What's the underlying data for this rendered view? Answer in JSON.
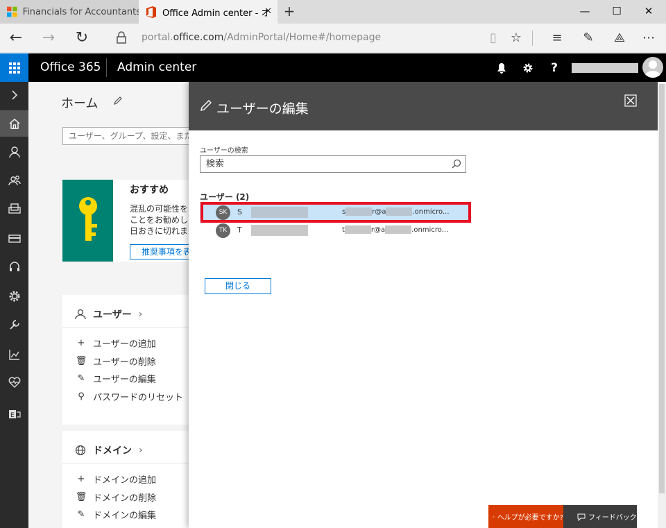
{
  "browser": {
    "tabs": [
      {
        "label": "Financials for Accountants—"
      },
      {
        "label": "Office Admin center - オ"
      }
    ],
    "url_prefix": "portal.",
    "url_domain": "office.com",
    "url_path": "/AdminPortal/Home#/homepage"
  },
  "header": {
    "brand": "Office 365",
    "app": "Admin center",
    "help_glyph": "?"
  },
  "home": {
    "title": "ホーム",
    "search_placeholder": "ユーザー、グループ、設定、また",
    "recommend": {
      "title": "おすすめ",
      "lines": [
        "混乱の可能性を",
        "ことをお勧めし",
        "日おきに切れま"
      ],
      "button": "推奨事項を表"
    },
    "users_card": {
      "title": "ユーザー",
      "items": [
        "ユーザーの追加",
        "ユーザーの削除",
        "ユーザーの編集",
        "パスワードのリセット"
      ]
    },
    "domains_card": {
      "title": "ドメイン",
      "items": [
        "ドメインの追加",
        "ドメインの削除",
        "ドメインの編集"
      ]
    }
  },
  "panel": {
    "title": "ユーザーの編集",
    "search_label": "ユーザーの検索",
    "search_placeholder": "検索",
    "users_label": "ユーザー (2)",
    "users": [
      {
        "initials": "SK",
        "name": "S",
        "email_a": "s",
        "email_b": "r@a",
        "email_c": ".onmicro..."
      },
      {
        "initials": "TK",
        "name": "T",
        "email_a": "t",
        "email_b": "r@a",
        "email_c": ".onmicro..."
      }
    ],
    "close_button": "閉じる"
  },
  "footer": {
    "help": "ヘルプが必要ですか?",
    "feedback": "フィードバック"
  },
  "colors": {
    "accent": "#0078d7",
    "help": "#d83b01",
    "highlight": "#e81123",
    "key_tile": "#008272"
  }
}
